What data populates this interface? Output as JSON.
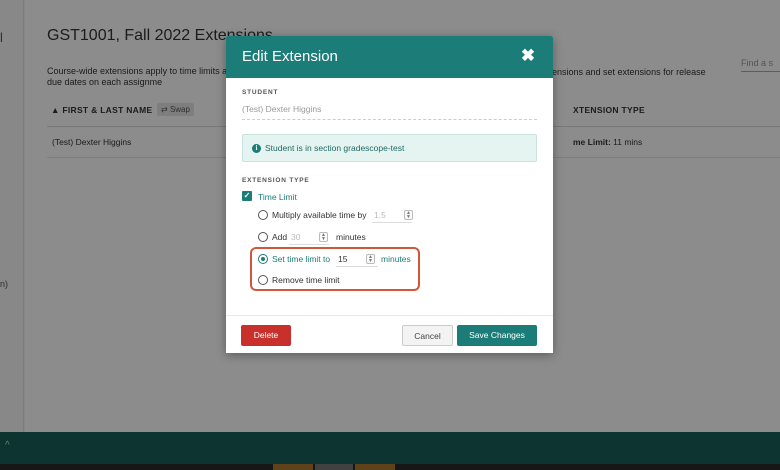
{
  "page": {
    "left_marks": [
      "l",
      "n)"
    ],
    "title": "GST1001, Fall 2022 Extensions",
    "description": "Course-wide extensions apply to time limits and due dates on each assignme",
    "description_right": "ensions and set extensions for release",
    "search_placeholder": "Find a s",
    "table": {
      "col_name": "FIRST & LAST NAME",
      "swap_label": "Swap",
      "col_type": "XTENSION TYPE",
      "row": {
        "name": "(Test) Dexter Higgins",
        "ext_prefix": "me Limit:",
        "ext_value": "11 mins"
      }
    }
  },
  "modal": {
    "title": "Edit Extension",
    "close_label": "✖",
    "student_label": "STUDENT",
    "student_name": "(Test) Dexter Higgins",
    "info_text": "Student is in section gradescope-test",
    "ext_type_label": "EXTENSION TYPE",
    "time_limit_label": "Time Limit",
    "options": {
      "multiply": {
        "label": "Multiply available time by",
        "value": "1.5"
      },
      "add": {
        "label": "Add",
        "value": "30",
        "suffix": "minutes"
      },
      "set": {
        "label": "Set time limit to",
        "value": "15",
        "suffix": "minutes"
      },
      "remove": {
        "label": "Remove time limit"
      }
    },
    "buttons": {
      "delete": "Delete",
      "cancel": "Cancel",
      "save": "Save Changes"
    }
  },
  "colors": {
    "accent": "#1b7c78",
    "danger": "#c8302c",
    "highlight": "#d0573c"
  }
}
